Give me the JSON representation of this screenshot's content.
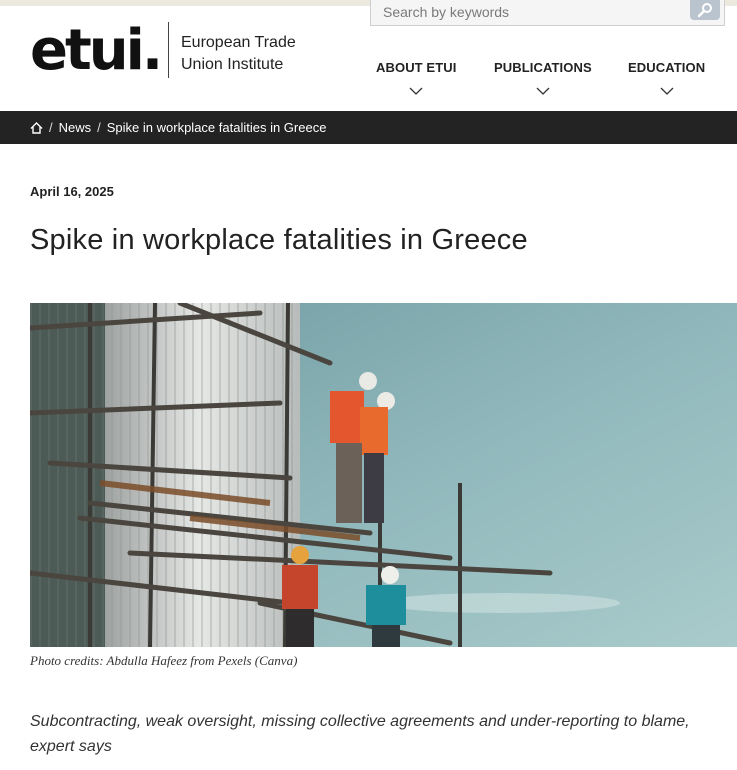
{
  "header": {
    "logo_text": "etui.",
    "logo_tagline_line1": "European Trade",
    "logo_tagline_line2": "Union Institute",
    "search_placeholder": "Search by keywords",
    "nav": [
      {
        "label": "ABOUT ETUI"
      },
      {
        "label": "PUBLICATIONS"
      },
      {
        "label": "EDUCATION"
      }
    ]
  },
  "breadcrumb": {
    "home_icon": "home-icon",
    "items": [
      "News",
      "Spike in workplace fatalities in Greece"
    ],
    "separator": "/"
  },
  "article": {
    "date": "April 16, 2025",
    "title": "Spike in workplace fatalities in Greece",
    "image_credit": "Photo credits: Abdulla Hafeez from Pexels (Canva)",
    "lead": "Subcontracting, weak oversight, missing collective agreements and under-reporting to blame, expert says"
  },
  "colors": {
    "breadcrumb_bg": "#232323",
    "search_button": "#b9c4cf",
    "top_strip": "#ece9df"
  }
}
